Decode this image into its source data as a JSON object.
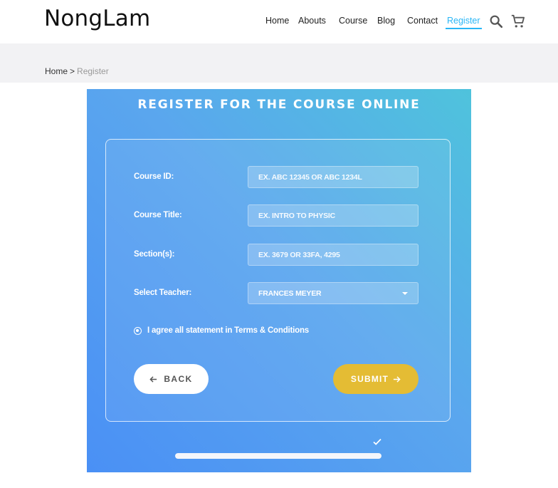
{
  "header": {
    "logo": "NongLam",
    "nav": [
      {
        "label": "Home",
        "active": false
      },
      {
        "label": "Abouts",
        "active": false
      },
      {
        "label": "Course",
        "active": false
      },
      {
        "label": "Blog",
        "active": false
      },
      {
        "label": "Contact",
        "active": false
      },
      {
        "label": "Register",
        "active": true
      }
    ],
    "icons": [
      "search-icon",
      "cart-icon"
    ],
    "accent_color": "#29b6f6"
  },
  "breadcrumb": {
    "home": "Home",
    "separator": ">",
    "current": "Register"
  },
  "form": {
    "title": "REGISTER FOR THE COURSE ONLINE",
    "fields": [
      {
        "label": "Course ID:",
        "placeholder": "EX. ABC 12345 OR ABC 1234L"
      },
      {
        "label": "Course Title:",
        "placeholder": "EX. INTRO TO PHYSIC"
      },
      {
        "label": "Section(s):",
        "placeholder": "EX. 3679 OR 33FA, 4295"
      }
    ],
    "teacher": {
      "label": "Select Teacher:",
      "value": "FRANCES MEYER"
    },
    "agree_text": "I agree all statement in Terms & Conditions",
    "back_label": "BACK",
    "submit_label": "SUBMIT",
    "submit_color": "#e4bc34",
    "progress": 1.0
  }
}
